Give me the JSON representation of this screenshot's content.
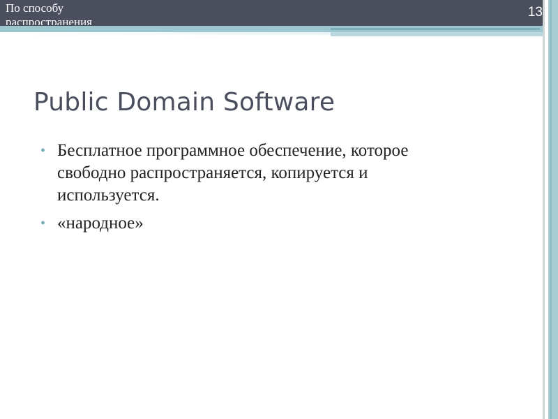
{
  "header": {
    "section_title": "По способу распространения",
    "slide_number": "13"
  },
  "title": "Public Domain Software",
  "bullets": [
    {
      "marker": "•",
      "text": "Бесплатное программное обеспечение, которое свободно распространяется,  копируется и используется."
    },
    {
      "marker": "•",
      "text": "«народное»"
    }
  ],
  "colors": {
    "header_band": "#4a4e5d",
    "accent_teal": "#9cc7cf",
    "bullet_marker": "#6fa8b4",
    "title_text": "#4a4e5d",
    "body_text": "#222222"
  }
}
